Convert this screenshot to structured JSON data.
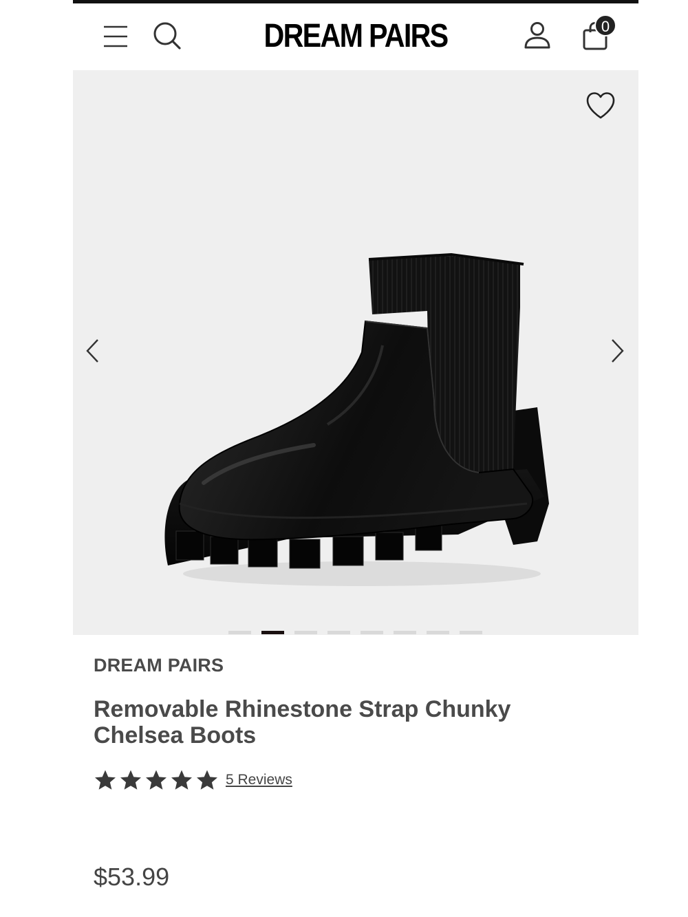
{
  "header": {
    "logo_text": "DREAM PAIRS",
    "cart_count": "0",
    "icons": [
      "hamburger-menu-icon",
      "search-icon",
      "user-icon",
      "shopping-bag-icon"
    ]
  },
  "gallery": {
    "image_alt": "Black chunky Chelsea boot",
    "slide_count": 8,
    "active_slide": 2,
    "icons": [
      "heart-icon",
      "chevron-left-icon",
      "chevron-right-icon"
    ],
    "background_color": "#efefef"
  },
  "product": {
    "brand": "DREAM PAIRS",
    "title": "Removable Rhinestone Strap Chunky Chelsea Boots",
    "rating": 5,
    "reviews_label": "5 Reviews",
    "price": "$53.99"
  },
  "colors": {
    "text": "#4a4a4a",
    "star": "#3a3a3a",
    "active_dot": "#1a1010",
    "inactive_dot": "#d9d9d9"
  }
}
